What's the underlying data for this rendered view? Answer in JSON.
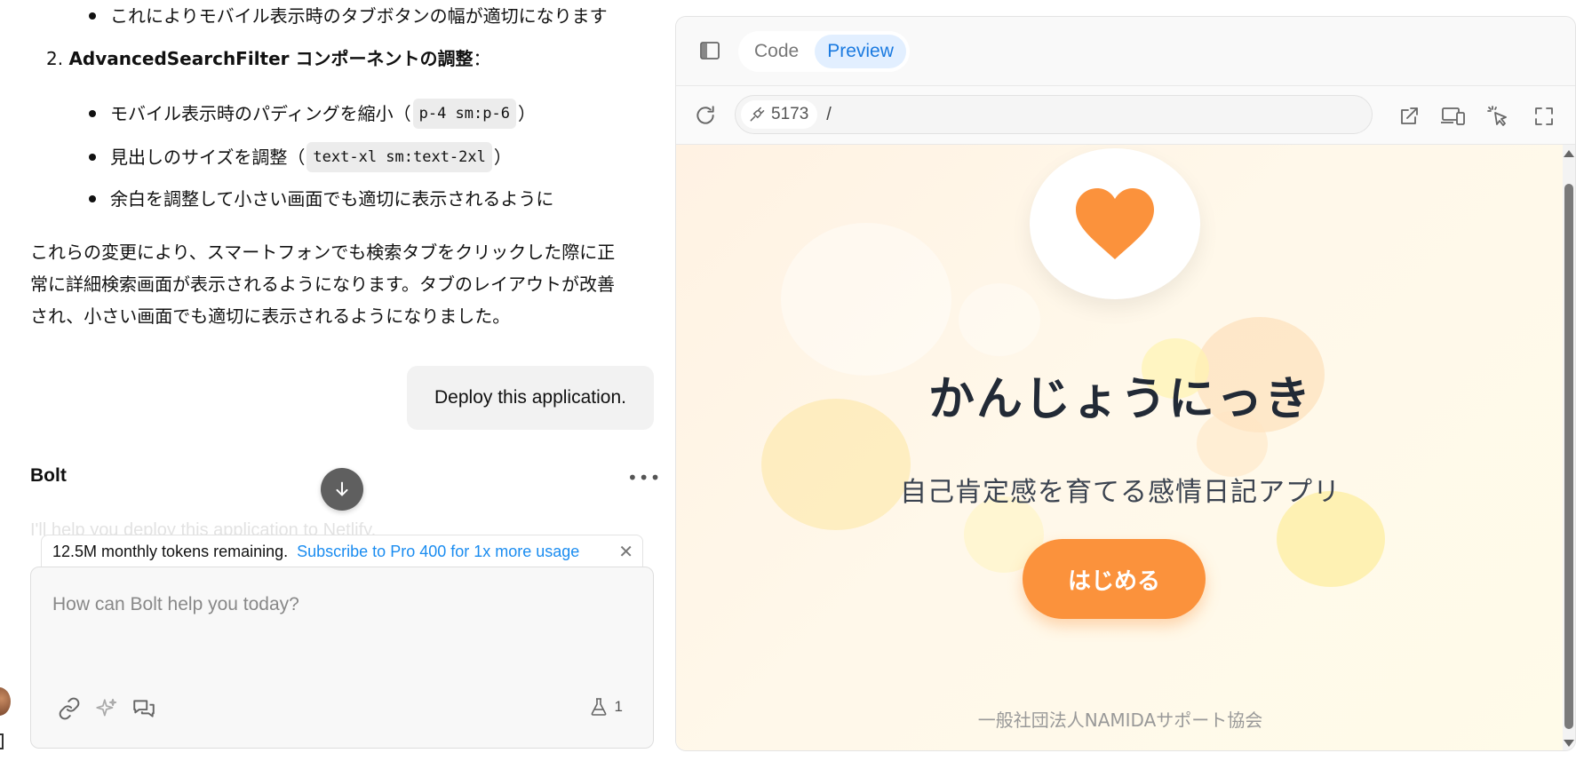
{
  "chat": {
    "top_bullet": "これによりモバイル表示時のタブボタンの幅が適切になります",
    "ordered_item": {
      "number": "2.",
      "title": "AdvancedSearchFilter コンポーネントの調整",
      "suffix": "："
    },
    "bullets": [
      {
        "text_before": "モバイル表示時のパディングを縮小（",
        "code": "p-4 sm:p-6",
        "text_after": "）"
      },
      {
        "text_before": "見出しのサイズを調整（",
        "code": "text-xl sm:text-2xl",
        "text_after": "）"
      },
      {
        "text_before": "余白を調整して小さい画面でも適切に表示されるように",
        "code": "",
        "text_after": ""
      }
    ],
    "paragraph_lines": [
      "これらの変更により、スマートフォンでも検索タブをクリックした際に正",
      "常に詳細検索画面が表示されるようになります。タブのレイアウトが改善",
      "され、小さい画面でも適切に表示されるようになりました。"
    ],
    "user_message": "Deploy this application.",
    "assistant_name": "Bolt",
    "faded_text": "I'll help you deploy this application to Netlify."
  },
  "token_bar": {
    "tokens": "12.5M monthly tokens remaining.",
    "subscribe": "Subscribe to Pro 400 for 1x more usage"
  },
  "composer": {
    "placeholder": "How can Bolt help you today?",
    "flask_count": "1",
    "icons": [
      "link-icon",
      "sparkles-icon",
      "chat-icon",
      "flask-icon"
    ]
  },
  "preview": {
    "tabs": [
      "Code",
      "Preview"
    ],
    "active_tab": "Preview",
    "port": "5173",
    "path": "/",
    "app": {
      "title": "かんじょうにっき",
      "subtitle": "自己肯定感を育てる感情日記アプリ",
      "button": "はじめる",
      "organization": "一般社団法人NAMIDAサポート協会"
    },
    "colors": {
      "accent": "#fb923c",
      "tab_active": "#1a7ae0",
      "link": "#1a8cf0"
    }
  }
}
